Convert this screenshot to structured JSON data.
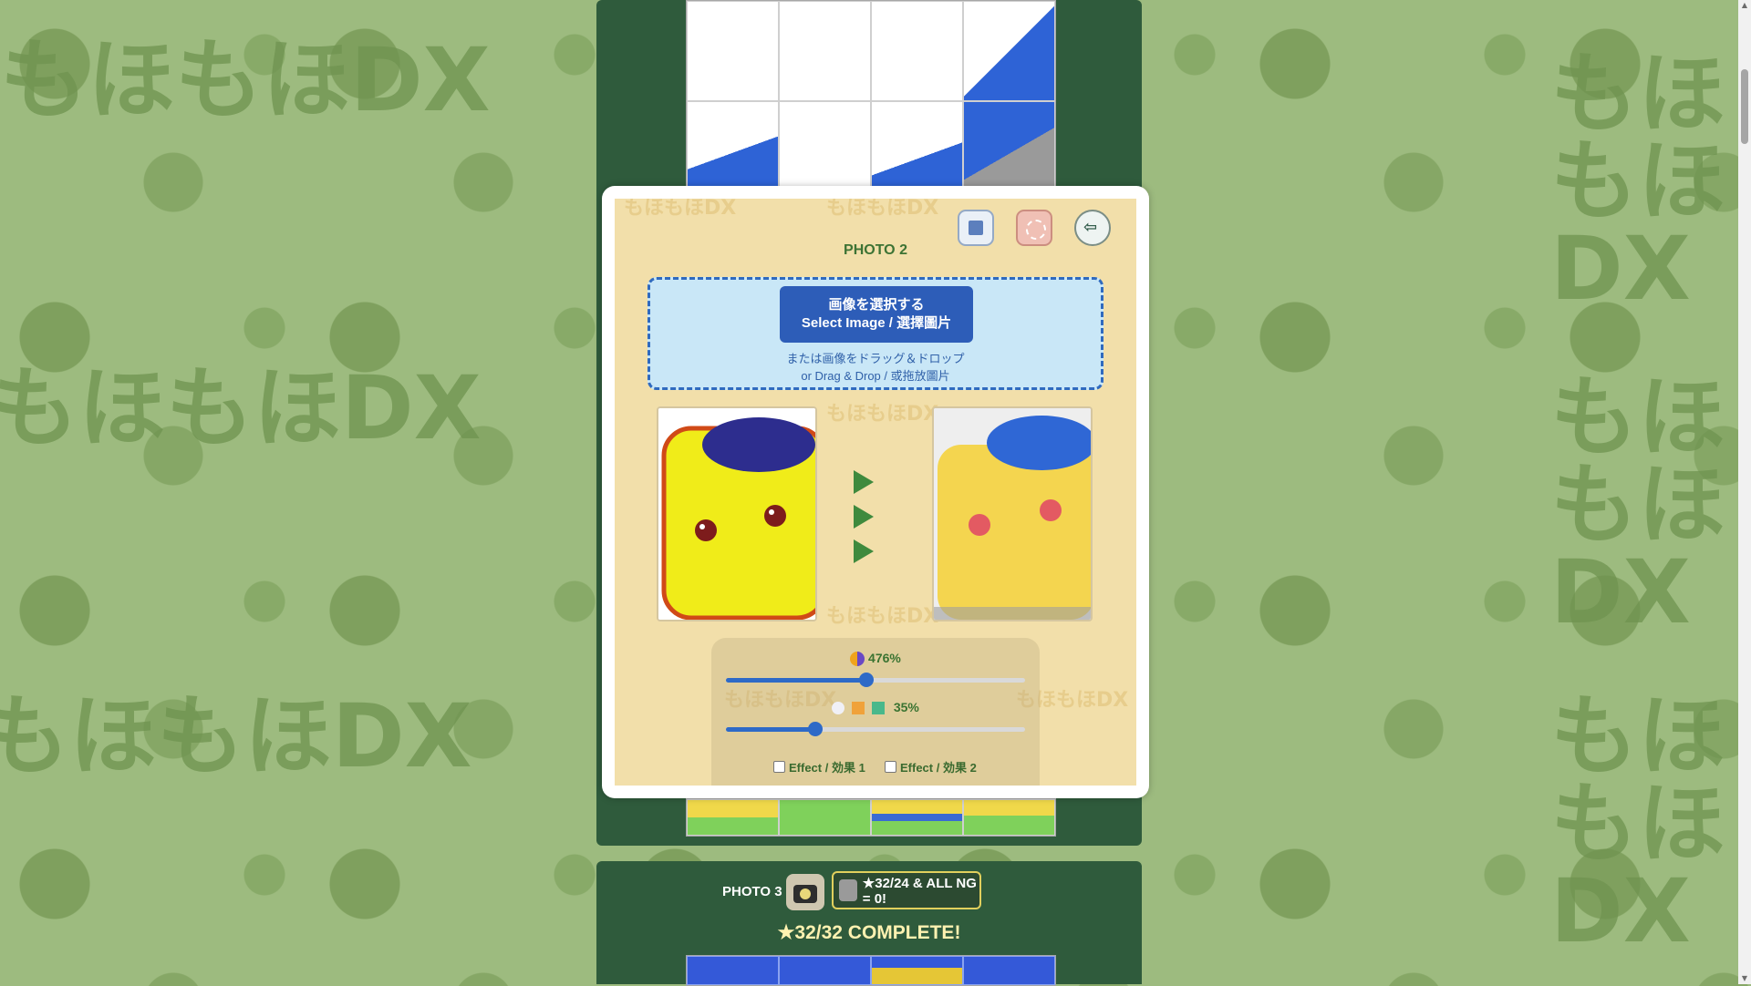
{
  "dialog": {
    "title": "PHOTO 2",
    "select_button": {
      "line1": "画像を選択する",
      "line2": "Select Image / 選擇圖片"
    },
    "drop_hint": {
      "line1": "または画像をドラッグ＆ドロップ",
      "line2": "or Drag & Drop / 或拖放圖片"
    },
    "slider1": {
      "value": "476%",
      "fraction": 0.47
    },
    "slider2": {
      "value": "35%",
      "fraction": 0.3
    },
    "effect1_label": "Effect / 効果 1",
    "effect2_label": "Effect / 効果 2",
    "watermark": "もほもほDX",
    "tools": {
      "save": "save-icon",
      "effect": "sparkle-icon",
      "back": "back-arrow-icon"
    }
  },
  "photo3": {
    "label": "PHOTO 3",
    "badge_text": "★32/24 & ALL NG = 0!",
    "complete_text": "★32/32 COMPLETE!"
  },
  "background_text": "もほもほDX",
  "colors": {
    "accent": "#2d5db8",
    "panel": "#2f5b3c",
    "dialog_bg": "#f2dfaa"
  }
}
